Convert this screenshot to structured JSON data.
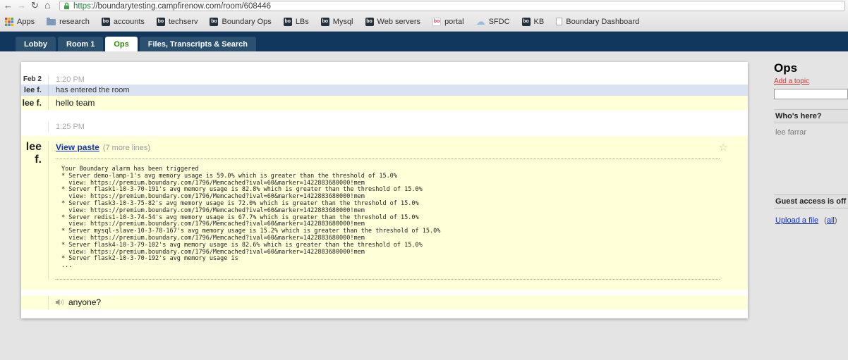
{
  "colors": {
    "header_navy": "#12375F",
    "active_tab_green": "#2E8B00",
    "message_yellow": "#FFFFD8",
    "enter_row_blue": "#D9E3F2",
    "link_blue": "#1133BB",
    "topic_link_red": "#D03333",
    "url_scheme_green": "#188038"
  },
  "icons": {
    "back": "←",
    "forward": "→",
    "reload": "↻",
    "home": "⌂",
    "cloud": "☁",
    "star": "☆"
  },
  "browser": {
    "url_scheme": "https",
    "url_rest": "://boundarytesting.campfirenow.com/room/608446",
    "bookmarks": [
      {
        "label": "Apps"
      },
      {
        "label": "research"
      },
      {
        "label": "accounts"
      },
      {
        "label": "techserv"
      },
      {
        "label": "Boundary Ops"
      },
      {
        "label": "LBs"
      },
      {
        "label": "Mysql"
      },
      {
        "label": "Web servers"
      },
      {
        "label": "portal"
      },
      {
        "label": "SFDC"
      },
      {
        "label": "KB"
      },
      {
        "label": "Boundary Dashboard"
      }
    ]
  },
  "tabs": [
    {
      "label": "Lobby"
    },
    {
      "label": "Room 1"
    },
    {
      "label": "Ops"
    },
    {
      "label": "Files, Transcripts & Search"
    }
  ],
  "chat": {
    "date_label": "Feb 2",
    "time_1": "1:20 PM",
    "enter_name": "lee f.",
    "enter_text": "has entered the room",
    "msg_1_name": "lee f.",
    "msg_1_text": "hello team",
    "time_2": "1:25 PM",
    "paste_name": "lee f.",
    "paste_link": "View paste",
    "paste_more": "(7 more lines)",
    "paste_body": "Your Boundary alarm has been triggered\n* Server demo-lamp-1's avg memory usage is 59.0% which is greater than the threshold of 15.0%\n  view: https://premium.boundary.com/1796/Memcached?ival=60&marker=1422883680000!mem\n* Server flask1-10-3-70-191's avg memory usage is 82.8% which is greater than the threshold of 15.0%\n  view: https://premium.boundary.com/1796/Memcached?ival=60&marker=1422883680000!mem\n* Server flask3-10-3-75-82's avg memory usage is 72.0% which is greater than the threshold of 15.0%\n  view: https://premium.boundary.com/1796/Memcached?ival=60&marker=1422883680000!mem\n* Server redis1-10-3-74-54's avg memory usage is 67.7% which is greater than the threshold of 15.0%\n  view: https://premium.boundary.com/1796/Memcached?ival=60&marker=1422883680000!mem\n* Server mysql-slave-10-3-78-167's avg memory usage is 15.2% which is greater than the threshold of 15.0%\n  view: https://premium.boundary.com/1796/Memcached?ival=60&marker=1422883680000!mem\n* Server flask4-10-3-79-102's avg memory usage is 82.6% which is greater than the threshold of 15.0%\n  view: https://premium.boundary.com/1796/Memcached?ival=60&marker=1422883680000!mem\n* Server flask2-10-3-70-192's avg memory usage is\n...",
    "msg_2_text": "anyone?"
  },
  "sidebar": {
    "room_title": "Ops",
    "add_topic_link": "Add a topic",
    "topic_input_value": "",
    "whos_here_header": "Who's here?",
    "user_1": "lee farrar",
    "guest_access_header": "Guest access is off",
    "upload_link": "Upload a file",
    "upload_all_prefix": "(",
    "upload_all_link": "all",
    "upload_all_suffix": ")"
  }
}
